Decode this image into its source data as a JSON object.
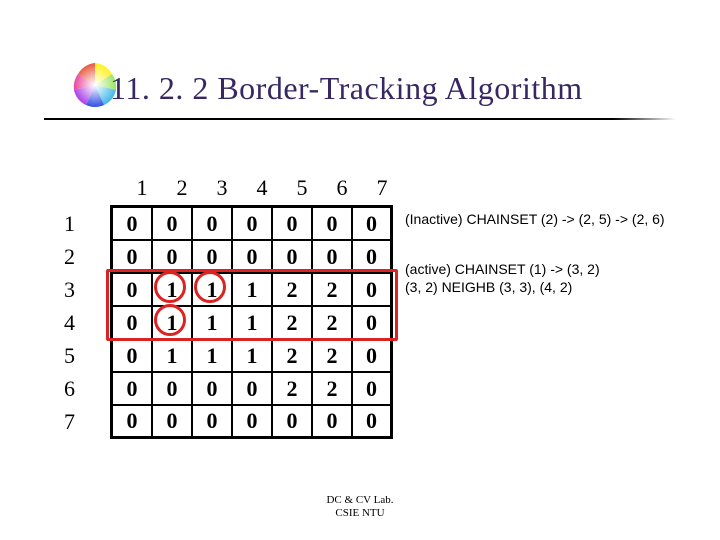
{
  "title": "11. 2. 2 Border-Tracking Algorithm",
  "col_headers": [
    "1",
    "2",
    "3",
    "4",
    "5",
    "6",
    "7"
  ],
  "row_headers": [
    "1",
    "2",
    "3",
    "4",
    "5",
    "6",
    "7"
  ],
  "grid": [
    [
      "0",
      "0",
      "0",
      "0",
      "0",
      "0",
      "0"
    ],
    [
      "0",
      "0",
      "0",
      "0",
      "0",
      "0",
      "0"
    ],
    [
      "0",
      "1",
      "1",
      "1",
      "2",
      "2",
      "0"
    ],
    [
      "0",
      "1",
      "1",
      "1",
      "2",
      "2",
      "0"
    ],
    [
      "0",
      "1",
      "1",
      "1",
      "2",
      "2",
      "0"
    ],
    [
      "0",
      "0",
      "0",
      "0",
      "2",
      "2",
      "0"
    ],
    [
      "0",
      "0",
      "0",
      "0",
      "0",
      "0",
      "0"
    ]
  ],
  "note_inactive": "(Inactive) CHAINSET (2) -> (2, 5) -> (2, 6)",
  "note_active_l1": "(active) CHAINSET (1) -> (3, 2)",
  "note_active_l2": "(3, 2) NEIGHB (3, 3), (4, 2)",
  "footer_l1": "DC & CV Lab.",
  "footer_l2": "CSIE NTU",
  "chart_data": {
    "type": "table",
    "title": "Labeled image matrix for border-tracking",
    "col_headers": [
      "1",
      "2",
      "3",
      "4",
      "5",
      "6",
      "7"
    ],
    "row_headers": [
      "1",
      "2",
      "3",
      "4",
      "5",
      "6",
      "7"
    ],
    "values": [
      [
        0,
        0,
        0,
        0,
        0,
        0,
        0
      ],
      [
        0,
        0,
        0,
        0,
        0,
        0,
        0
      ],
      [
        0,
        1,
        1,
        1,
        2,
        2,
        0
      ],
      [
        0,
        1,
        1,
        1,
        2,
        2,
        0
      ],
      [
        0,
        1,
        1,
        1,
        2,
        2,
        0
      ],
      [
        0,
        0,
        0,
        0,
        2,
        2,
        0
      ],
      [
        0,
        0,
        0,
        0,
        0,
        0,
        0
      ]
    ],
    "highlights": {
      "red_box_rows": [
        3,
        4
      ],
      "red_box_cols": [
        1,
        2,
        3,
        4,
        5,
        6,
        7
      ],
      "red_circles": [
        [
          3,
          2
        ],
        [
          3,
          3
        ],
        [
          4,
          2
        ]
      ]
    }
  }
}
